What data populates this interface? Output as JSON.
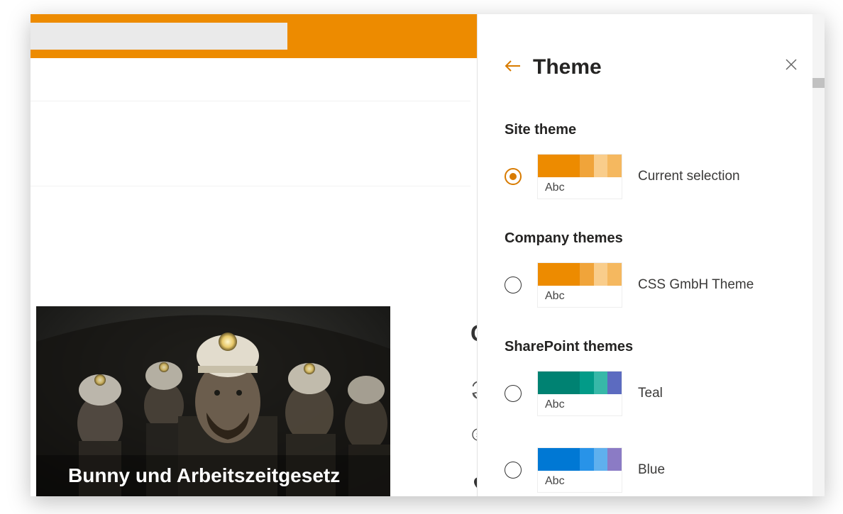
{
  "topbar": {
    "search_placeholder": ""
  },
  "hero": {
    "title": "Bunny und Arbeitszeitgesetz"
  },
  "quick": {
    "heading": "Qu"
  },
  "panel": {
    "title": "Theme",
    "site_section": "Site theme",
    "company_section": "Company themes",
    "sharepoint_section": "SharePoint themes",
    "abc": "Abc",
    "items": {
      "current": {
        "label": "Current selection"
      },
      "css": {
        "label": "CSS GmbH Theme"
      },
      "teal": {
        "label": "Teal"
      },
      "blue": {
        "label": "Blue"
      }
    }
  },
  "colors": {
    "orange": [
      "#ed8b00",
      "#f0a43a",
      "#f5b85f",
      "#f9cd8b"
    ],
    "teal": [
      "#008272",
      "#029b88",
      "#37b8a8",
      "#5c6bc0"
    ],
    "blue": [
      "#0078d4",
      "#2893e8",
      "#5fb0ee",
      "#8b7bc5"
    ]
  }
}
